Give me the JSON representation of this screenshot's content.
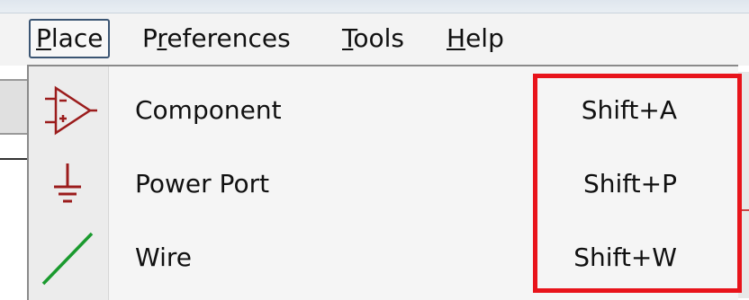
{
  "menubar": {
    "items": [
      {
        "label": "Place",
        "accel": "P",
        "rest": "lace",
        "active": true
      },
      {
        "label": "Preferences",
        "pre": "P",
        "accel": "r",
        "rest": "eferences"
      },
      {
        "label": "Tools",
        "accel": "T",
        "rest": "ools"
      },
      {
        "label": "Help",
        "accel": "H",
        "rest": "elp"
      }
    ]
  },
  "dropdown": {
    "items": [
      {
        "label": "Component",
        "shortcut": "Shift+A",
        "icon": "component-icon"
      },
      {
        "label": "Power Port",
        "shortcut": "Shift+P",
        "icon": "power-port-icon"
      },
      {
        "label": "Wire",
        "shortcut": "Shift+W",
        "icon": "wire-icon"
      }
    ]
  },
  "colors": {
    "highlight": "#e8141b",
    "component_icon": "#9b1c1c",
    "wire_icon": "#1a9a2e"
  }
}
